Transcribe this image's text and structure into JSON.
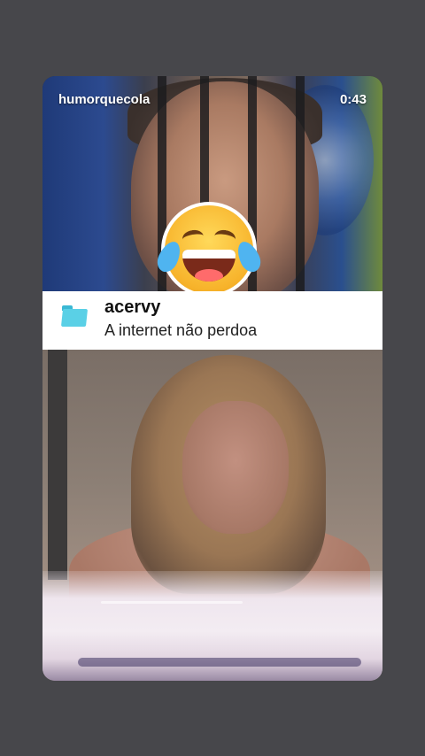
{
  "story": {
    "username": "humorquecola",
    "timer": "0:43"
  },
  "caption": {
    "account": "acervy",
    "text": "A internet não perdoa",
    "icon": "folder-icon",
    "icon_color": "#5ad0e6"
  },
  "overlay": {
    "emoji": "crying-laughing-emoji"
  },
  "colors": {
    "background": "#47474b",
    "caption_background": "#ffffff"
  }
}
